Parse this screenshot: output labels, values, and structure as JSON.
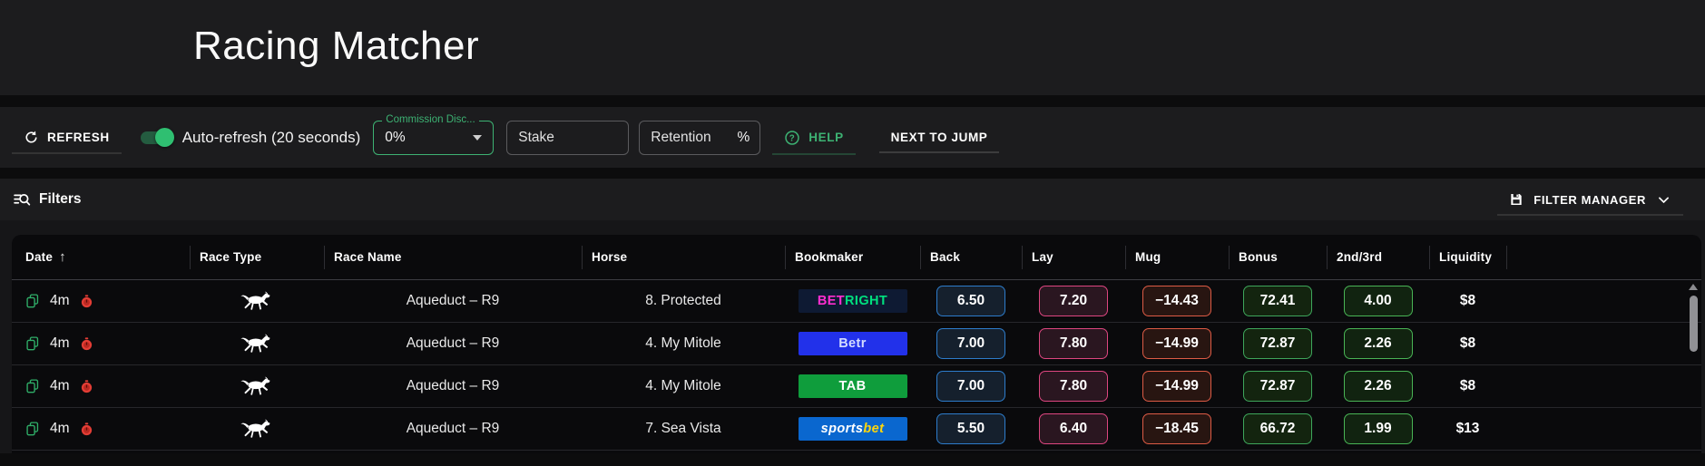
{
  "header": {
    "title": "Racing Matcher"
  },
  "toolbar": {
    "refresh_label": "REFRESH",
    "auto_refresh_label": "Auto-refresh (20 seconds)",
    "auto_refresh_on": true,
    "commission": {
      "label": "Commission Disc...",
      "value": "0%"
    },
    "stake_placeholder": "Stake",
    "retention_placeholder": "Retention",
    "retention_suffix": "%",
    "help_label": "HELP",
    "next_to_jump_label": "NEXT TO JUMP"
  },
  "filters": {
    "label": "Filters",
    "manager_label": "FILTER MANAGER"
  },
  "icons": {
    "sort_asc": "↑",
    "help_glyph": "?"
  },
  "colors": {
    "accent_green": "#3db273",
    "toggle_on": "#2fbf71",
    "back_border": "#2d7ccb",
    "back_bg": "#15202d",
    "lay_border": "#de4680",
    "lay_bg": "#2a1620",
    "mug_border": "#dd5b45",
    "mug_bg": "#281511",
    "bonus_border": "#3ea65b",
    "bonus_bg": "#13240f",
    "second_border": "#49b455",
    "second_bg": "#112310",
    "timer_red": "#e33d35",
    "copy_green": "#2fae68"
  },
  "table": {
    "columns": [
      "Date",
      "Race Type",
      "Race Name",
      "Horse",
      "Bookmaker",
      "Back",
      "Lay",
      "Mug",
      "Bonus",
      "2nd/3rd",
      "Liquidity"
    ],
    "sort_column": "Date",
    "sort_direction": "asc",
    "rows": [
      {
        "time": "4m",
        "race_name": "Aqueduct – R9",
        "horse": "8. Protected",
        "bookmaker": {
          "name": "BetRight",
          "bg": "#0e1a33",
          "parts": [
            {
              "text": "BET",
              "color": "#ff2ed0"
            },
            {
              "text": "RIGHT",
              "color": "#00df7e"
            }
          ]
        },
        "back": "6.50",
        "lay": "7.20",
        "mug": "−14.43",
        "bonus": "72.41",
        "second_third": "4.00",
        "liquidity": "$8"
      },
      {
        "time": "4m",
        "race_name": "Aqueduct – R9",
        "horse": "4. My Mitole",
        "bookmaker": {
          "name": "Betr",
          "bg": "#2231ea",
          "parts": [
            {
              "text": "Betr",
              "color": "#d3dcff"
            }
          ]
        },
        "back": "7.00",
        "lay": "7.80",
        "mug": "−14.99",
        "bonus": "72.87",
        "second_third": "2.26",
        "liquidity": "$8"
      },
      {
        "time": "4m",
        "race_name": "Aqueduct – R9",
        "horse": "4. My Mitole",
        "bookmaker": {
          "name": "TAB",
          "bg": "#0f9d3c",
          "parts": [
            {
              "text": "TAB",
              "color": "#ffffff"
            }
          ]
        },
        "back": "7.00",
        "lay": "7.80",
        "mug": "−14.99",
        "bonus": "72.87",
        "second_third": "2.26",
        "liquidity": "$8"
      },
      {
        "time": "4m",
        "race_name": "Aqueduct – R9",
        "horse": "7. Sea Vista",
        "bookmaker": {
          "name": "Sportsbet",
          "bg": "#0a67cf",
          "italic": true,
          "parts": [
            {
              "text": "sports",
              "color": "#ffffff"
            },
            {
              "text": "bet",
              "color": "#ffd60a"
            }
          ]
        },
        "back": "5.50",
        "lay": "6.40",
        "mug": "−18.45",
        "bonus": "66.72",
        "second_third": "1.99",
        "liquidity": "$13"
      }
    ]
  }
}
